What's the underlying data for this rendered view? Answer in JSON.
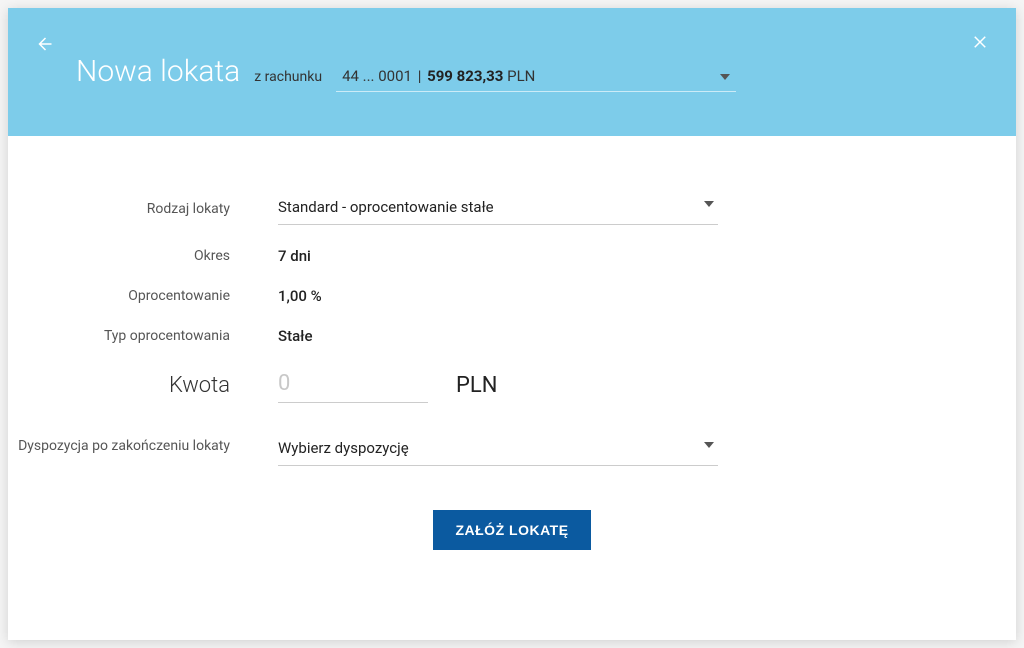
{
  "header": {
    "title": "Nowa lokata",
    "subtitle": "z rachunku",
    "account": {
      "masked_number": "44 ... 0001",
      "balance": "599 823,33",
      "currency": "PLN"
    }
  },
  "form": {
    "type_label": "Rodzaj lokaty",
    "type_value": "Standard - oprocentowanie stałe",
    "period_label": "Okres",
    "period_value": "7 dni",
    "rate_label": "Oprocentowanie",
    "rate_value": "1,00 %",
    "rate_type_label": "Typ oprocentowania",
    "rate_type_value": "Stałe",
    "amount_label": "Kwota",
    "amount_placeholder": "0",
    "amount_value": "",
    "amount_currency": "PLN",
    "disposition_label": "Dyspozycja po zakończeniu lokaty",
    "disposition_value": "Wybierz dyspozycję"
  },
  "actions": {
    "submit": "ZAŁÓŻ LOKATĘ"
  }
}
